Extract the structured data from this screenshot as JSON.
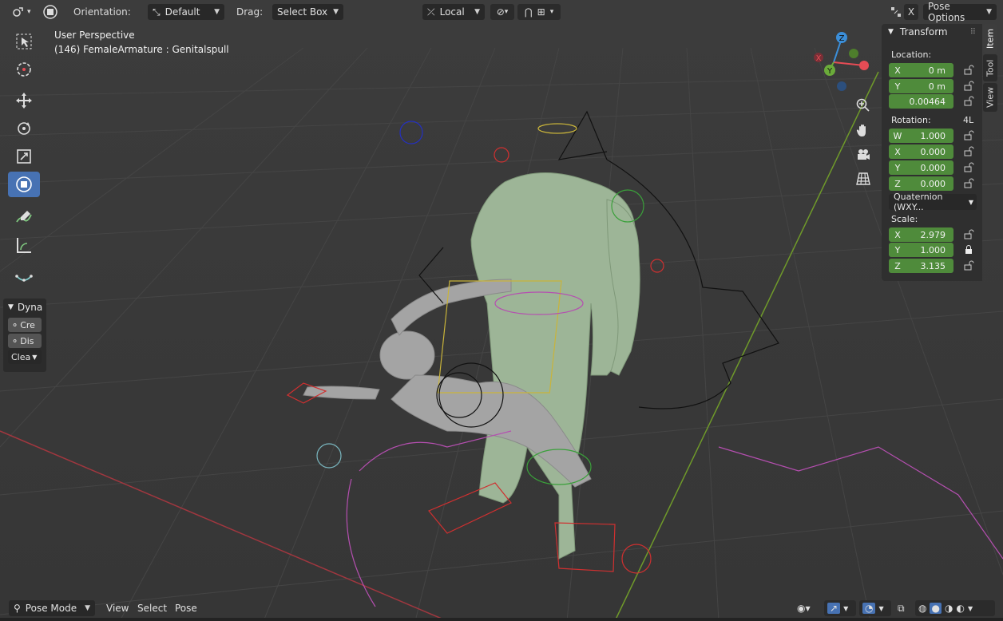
{
  "header": {
    "orientation_label": "Orientation:",
    "orientation_value": "Default",
    "drag_label": "Drag:",
    "drag_value": "Select Box",
    "pivot_value": "Local",
    "x_label": "X",
    "pose_options": "Pose Options"
  },
  "viewport": {
    "perspective": "User Perspective",
    "object_info": "(146) FemaleArmature : Genitalspull",
    "gizmo": {
      "z": "Z",
      "y": "Y",
      "x": "X"
    }
  },
  "dyna_panel": {
    "title": "Dyna",
    "create_label": "Cre",
    "dissolve_label": "Dis",
    "clear_label": "Clea"
  },
  "transform_panel": {
    "title": "Transform",
    "location_label": "Location:",
    "location": [
      {
        "axis": "X",
        "value": "0 m"
      },
      {
        "axis": "Y",
        "value": "0 m"
      },
      {
        "axis": "",
        "value": "0.00464"
      }
    ],
    "rotation_label": "Rotation:",
    "rotation_mode_short": "4L",
    "rotation": [
      {
        "axis": "W",
        "value": "1.000"
      },
      {
        "axis": "X",
        "value": "0.000"
      },
      {
        "axis": "Y",
        "value": "0.000"
      },
      {
        "axis": "Z",
        "value": "0.000"
      }
    ],
    "rotation_mode": "Quaternion (WXY...",
    "scale_label": "Scale:",
    "scale": [
      {
        "axis": "X",
        "value": "2.979"
      },
      {
        "axis": "Y",
        "value": "1.000"
      },
      {
        "axis": "Z",
        "value": "3.135"
      }
    ]
  },
  "sidebar_tabs": [
    "Item",
    "Tool",
    "View"
  ],
  "bottom": {
    "mode": "Pose Mode",
    "menu": [
      "View",
      "Select",
      "Pose"
    ]
  },
  "colors": {
    "accent": "#4772b3",
    "field_green": "#4f8b3b",
    "viewport_bg": "#3a3a3a",
    "axis_x": "#e64c55",
    "axis_y": "#6bab3a",
    "axis_z": "#3b8ed8"
  },
  "icons": [
    "select-box-icon",
    "cursor-icon",
    "move-icon",
    "rotate-icon",
    "scale-icon",
    "transform-icon",
    "annotate-icon",
    "measure-icon",
    "zoom-icon",
    "hand-icon",
    "camera-icon",
    "grid-icon",
    "lock-icon"
  ]
}
